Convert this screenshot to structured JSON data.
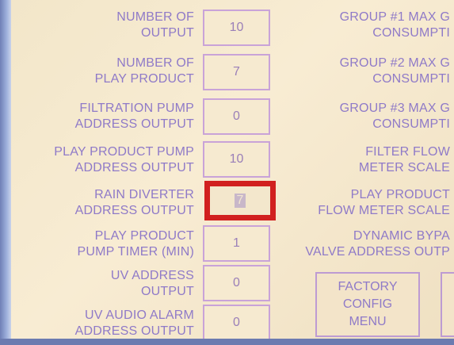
{
  "left_fields": [
    {
      "label_line1": "NUMBER OF",
      "label_line2": "OUTPUT",
      "value": "10"
    },
    {
      "label_line1": "NUMBER OF",
      "label_line2": "PLAY PRODUCT",
      "value": "7"
    },
    {
      "label_line1": "FILTRATION PUMP",
      "label_line2": "ADDRESS OUTPUT",
      "value": "0"
    },
    {
      "label_line1": "PLAY PRODUCT PUMP",
      "label_line2": "ADDRESS OUTPUT",
      "value": "10"
    },
    {
      "label_line1": "RAIN DIVERTER",
      "label_line2": "ADDRESS OUTPUT",
      "value": "7"
    },
    {
      "label_line1": "PLAY PRODUCT",
      "label_line2": "PUMP TIMER (MIN)",
      "value": "1"
    },
    {
      "label_line1": "UV ADDRESS",
      "label_line2": "OUTPUT",
      "value": "0"
    },
    {
      "label_line1": "UV AUDIO ALARM",
      "label_line2": "ADDRESS OUTPUT",
      "value": "0"
    }
  ],
  "right_fields": [
    {
      "label_line1": "GROUP #1 MAX G",
      "label_line2": "CONSUMPTI"
    },
    {
      "label_line1": "GROUP #2 MAX G",
      "label_line2": "CONSUMPTI"
    },
    {
      "label_line1": "GROUP #3 MAX G",
      "label_line2": "CONSUMPTI"
    },
    {
      "label_line1": "FILTER FLOW",
      "label_line2": "METER SCALE"
    },
    {
      "label_line1": "PLAY PRODUCT",
      "label_line2": "FLOW METER SCALE"
    },
    {
      "label_line1": "DYNAMIC BYPA",
      "label_line2": "VALVE ADDRESS OUTP"
    }
  ],
  "factory_button": {
    "line1": "FACTORY",
    "line2": "CONFIG",
    "line3": "MENU"
  },
  "selected_field": "rain-diverter-address-output",
  "colors": {
    "label": "#8f7ac8",
    "highlight": "#d1201f",
    "background": "#f4e8cf"
  }
}
